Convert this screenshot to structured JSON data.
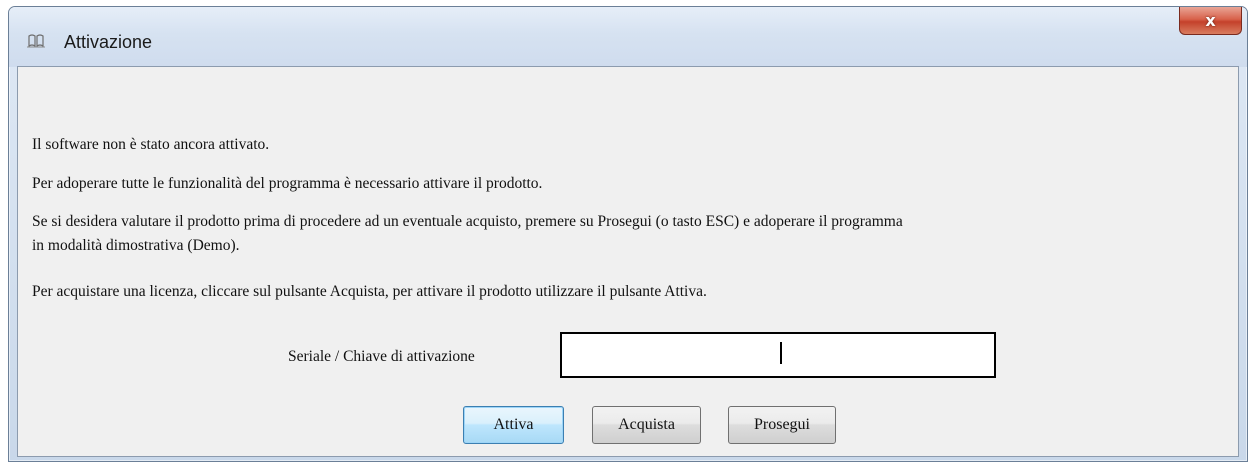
{
  "window": {
    "title": "Attivazione",
    "close_label": "x"
  },
  "messages": [
    "Il software non è stato ancora attivato.",
    "Per adoperare tutte le funzionalità del programma è necessario attivare il prodotto.",
    "Se si desidera valutare il prodotto prima di procedere ad un eventuale acquisto, premere su Prosegui (o tasto ESC) e adoperare il programma",
    "in modalità dimostrativa (Demo).",
    "Per acquistare una licenza, cliccare sul pulsante Acquista, per attivare il prodotto utilizzare il pulsante Attiva."
  ],
  "serial": {
    "label": "Seriale / Chiave di attivazione",
    "value": ""
  },
  "buttons": {
    "activate": "Attiva",
    "buy": "Acquista",
    "continue": "Prosegui"
  },
  "colors": {
    "close_button": "#c4412b",
    "default_button": "#bee6fd",
    "client_background": "#f0f0f0"
  }
}
